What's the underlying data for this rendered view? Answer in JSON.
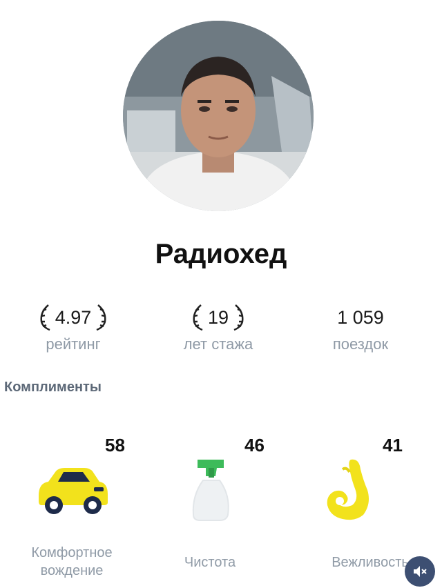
{
  "profile": {
    "name": "Радиохед"
  },
  "stats": {
    "rating": {
      "value": "4.97",
      "label": "рейтинг"
    },
    "years": {
      "value": "19",
      "label": "лет стажа"
    },
    "trips": {
      "value": "1 059",
      "label": "поездок"
    }
  },
  "compliments": {
    "title": "Комплименты",
    "items": [
      {
        "count": "58",
        "label_line1": "Комфортное",
        "label_line2": "вождение",
        "icon": "car-icon"
      },
      {
        "count": "46",
        "label_line1": "Чистота",
        "label_line2": "",
        "icon": "spray-bottle-icon"
      },
      {
        "count": "41",
        "label_line1": "Вежливость",
        "label_line2": "",
        "icon": "ok-hand-icon"
      }
    ]
  },
  "colors": {
    "accent_yellow": "#f2e21c",
    "label_gray": "#8f9aa6",
    "section_gray": "#5d6978",
    "sound_button_bg": "#3d4f72"
  },
  "controls": {
    "sound_icon": "sound-off-icon"
  }
}
